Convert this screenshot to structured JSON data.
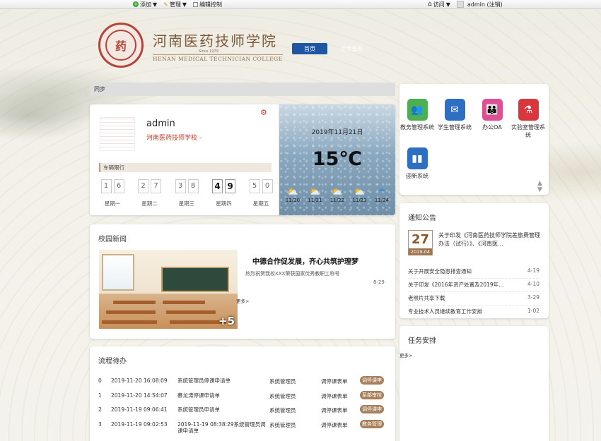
{
  "topbar": {
    "add": "添加",
    "manage": "管理",
    "edit_control": "编辑控制",
    "visit": "访问",
    "user": "admin (注销)"
  },
  "header": {
    "logo_cn": "河南医药技师学院",
    "logo_since": "Since 1979",
    "logo_en": "HENAN MEDICAL TECHNICIAN COLLEGE",
    "nav": [
      "首页",
      "应用管理"
    ]
  },
  "breadcrumb": "同步",
  "profile": {
    "name": "admin",
    "school": "河南医药技师学校 -",
    "restriction_title": "车辆限行",
    "plates": [
      {
        "digits": [
          "1",
          "6"
        ],
        "day": "星期一",
        "active": false
      },
      {
        "digits": [
          "2",
          "7"
        ],
        "day": "星期二",
        "active": false
      },
      {
        "digits": [
          "3",
          "8"
        ],
        "day": "星期三",
        "active": false
      },
      {
        "digits": [
          "4",
          "9"
        ],
        "day": "星期四",
        "active": true
      },
      {
        "digits": [
          "5",
          "0"
        ],
        "day": "星期五",
        "active": false
      }
    ]
  },
  "weather": {
    "date": "2019年11月21日",
    "temp": "15℃",
    "days": [
      {
        "date": "11/20",
        "icon": "partly-sunny-icon"
      },
      {
        "date": "11/21",
        "icon": "partly-sunny-icon"
      },
      {
        "date": "11/22",
        "icon": "partly-sunny-icon"
      },
      {
        "date": "11/23",
        "icon": "partly-sunny-icon"
      },
      {
        "date": "11/24",
        "icon": "rain-icon"
      }
    ]
  },
  "news": {
    "title": "校园新闻",
    "headline": "中德合作促发展，齐心共筑护理梦",
    "sub": "热烈祝贺我校XXX荣获国家优秀教职工称号",
    "date": "8-29",
    "more": "更多>",
    "image_badge": "+5"
  },
  "process": {
    "title": "流程待办",
    "rows": [
      {
        "idx": "0",
        "time": "2019-11-20 16:08:09",
        "title": "系统管理员停课申请单",
        "user": "系统管理员",
        "form": "调停课表单",
        "status": "调停课申"
      },
      {
        "idx": "1",
        "time": "2019-11-20 14:54:07",
        "title": "慕龙涛停课申请单",
        "user": "系统管理员",
        "form": "调停课表单",
        "status": "系部审核"
      },
      {
        "idx": "2",
        "time": "2019-11-19 09:06:41",
        "title": "系统管理员申请单",
        "user": "系统管理员",
        "form": "调停课表单",
        "status": "调停课申"
      },
      {
        "idx": "3",
        "time": "2019-11-19 09:02:53",
        "title": "2019-11-19 08:38:29系统管理员调课申请单",
        "user": "系统管理员",
        "form": "调停课表单",
        "status": "教务管理"
      }
    ]
  },
  "apps": [
    {
      "label": "教务管理系统",
      "icon": "people-icon",
      "color": "#4caf50"
    },
    {
      "label": "学生管理系统",
      "icon": "student-icon",
      "color": "#2e6fc4"
    },
    {
      "label": "办公OA",
      "icon": "group-icon",
      "color": "#e04f94"
    },
    {
      "label": "实验室管理系统",
      "icon": "lab-icon",
      "color": "#d9363e"
    },
    {
      "label": "迎新系统",
      "icon": "chart-icon",
      "color": "#2e6fc4"
    }
  ],
  "notices": {
    "title": "通知公告",
    "featured": {
      "day": "27",
      "month": "2019-04",
      "text": "关于印发《河南医药技师学院差旅费管理办法（试行）》、《河南医..."
    },
    "items": [
      {
        "title": "关于开展安全隐患排查通知",
        "date": "4-19"
      },
      {
        "title": "关于印发《2016年资产处置及2019年...",
        "date": "4-10"
      },
      {
        "title": "老照片共享下载",
        "date": "3-29"
      },
      {
        "title": "专业技术人员继续教育工作安排",
        "date": "1-02"
      }
    ]
  },
  "tasks": {
    "title": "任务安排",
    "more": "更多>"
  }
}
